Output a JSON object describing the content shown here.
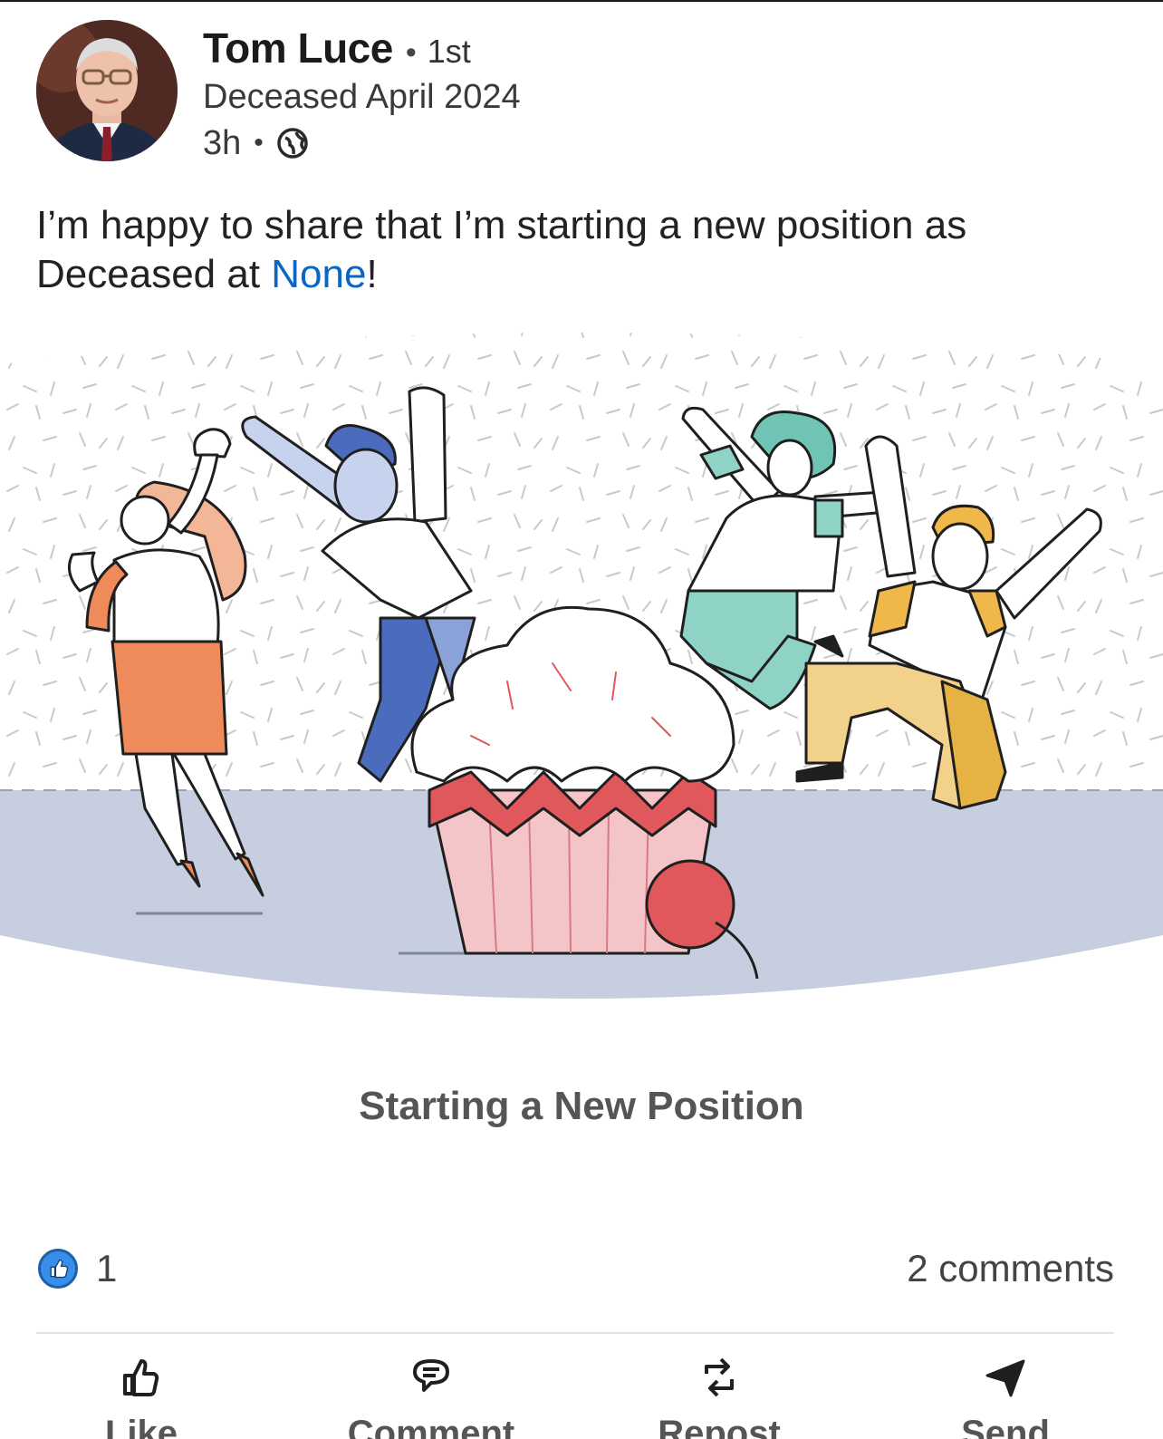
{
  "post": {
    "author": {
      "name": "Tom Luce",
      "degree": "1st",
      "headline": "Deceased April 2024"
    },
    "meta": {
      "time": "3h",
      "visibility_icon": "globe-icon"
    },
    "text_before": "I’m happy to share that I’m starting a new position as Deceased at ",
    "text_link": "None",
    "text_after": "!",
    "card": {
      "title": "Starting a New Position"
    },
    "social": {
      "reaction_icon": "like-reaction-icon",
      "reaction_count": "1",
      "comments": "2 comments"
    },
    "actions": [
      {
        "label": "Like",
        "icon": "thumbs-up-icon"
      },
      {
        "label": "Comment",
        "icon": "comment-icon"
      },
      {
        "label": "Repost",
        "icon": "repost-icon"
      },
      {
        "label": "Send",
        "icon": "send-icon"
      }
    ]
  },
  "colors": {
    "link": "#0a66c2",
    "floor": "#c6cedf",
    "reaction": "#378fe9"
  }
}
